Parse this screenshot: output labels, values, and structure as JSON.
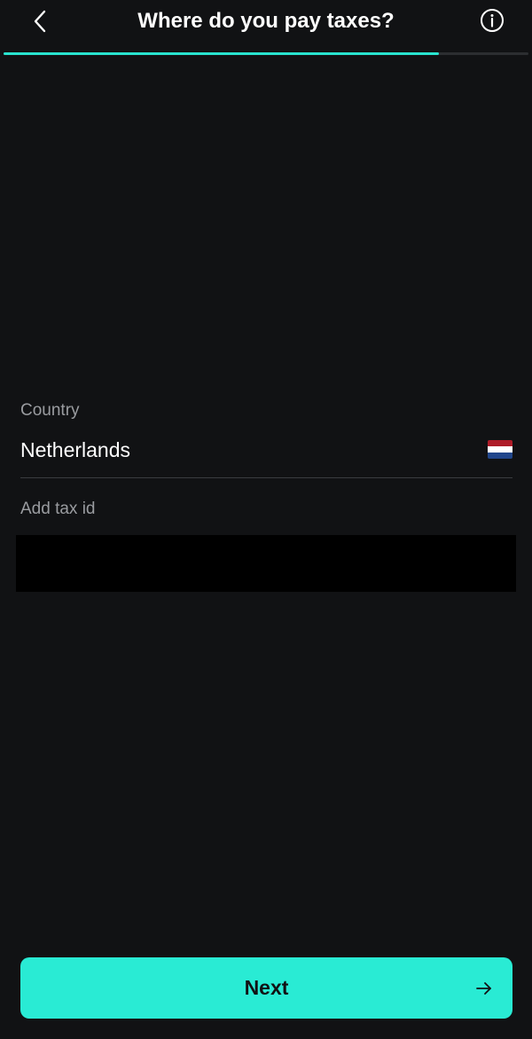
{
  "header": {
    "title": "Where do you pay taxes?",
    "back_icon": "chevron-left-icon",
    "info_icon": "info-circle-icon"
  },
  "progress": {
    "fraction": 0.83,
    "fill_color": "#29e4cf",
    "track_color": "#2c2e31"
  },
  "form": {
    "country": {
      "label": "Country",
      "value": "Netherlands",
      "flag_icon": "netherlands-flag-icon",
      "flag_colors": [
        "#ae1c28",
        "#ffffff",
        "#21468b"
      ]
    },
    "tax_id": {
      "label": "Add tax id",
      "value": ""
    }
  },
  "footer": {
    "next_label": "Next",
    "next_icon": "arrow-right-icon",
    "button_color": "#29ebd4"
  },
  "colors": {
    "background": "#111214",
    "accent": "#29e4cf"
  }
}
